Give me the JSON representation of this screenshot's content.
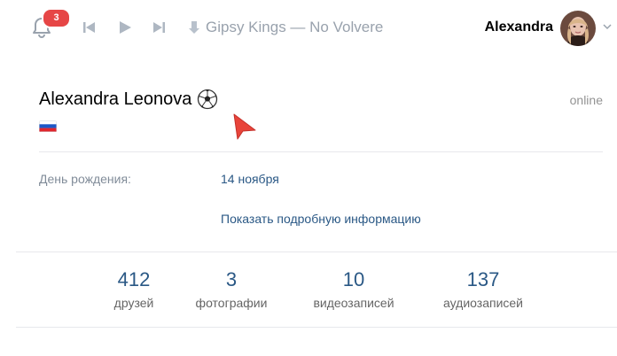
{
  "topbar": {
    "notifications_count": "3",
    "track_title": "Gipsy Kings — No Volvere",
    "username": "Alexandra"
  },
  "profile": {
    "full_name": "Alexandra Leonova",
    "status": "online",
    "flag": "russia-flag",
    "emoji": "soccer-ball-icon"
  },
  "info": {
    "birthday_label": "День рождения:",
    "birthday_value": "14 ноября",
    "more_link": "Показать подробную информацию"
  },
  "counters": [
    {
      "value": "412",
      "label": "друзей"
    },
    {
      "value": "3",
      "label": "фотографии"
    },
    {
      "value": "10",
      "label": "видеозаписей"
    },
    {
      "value": "137",
      "label": "аудиозаписей"
    }
  ],
  "colors": {
    "link": "#2a5885",
    "badge": "#e64646",
    "muted": "#99a2ad",
    "cursor": "#e8443a"
  }
}
